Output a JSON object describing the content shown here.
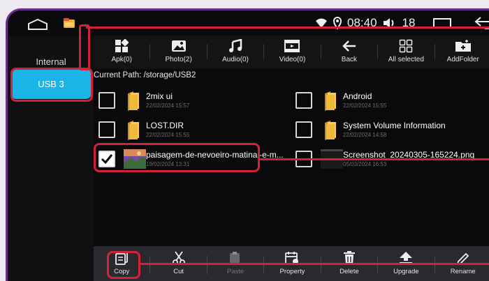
{
  "status": {
    "time": "08:40",
    "volume": "18",
    "volume_icon": "speaker-icon",
    "wifi_icon": "wifi-icon",
    "location_icon": "location-pin-icon"
  },
  "sidebar": {
    "items": [
      {
        "label": "Internal"
      },
      {
        "label": "USB 3",
        "selected": true
      }
    ]
  },
  "toolbar": {
    "items": [
      {
        "label": "Apk(0)",
        "icon": "apps-icon"
      },
      {
        "label": "Photo(2)",
        "icon": "image-icon"
      },
      {
        "label": "Audio(0)",
        "icon": "music-note-icon"
      },
      {
        "label": "Video(0)",
        "icon": "film-icon"
      },
      {
        "label": "Back",
        "icon": "arrow-left-icon"
      },
      {
        "label": "All selected",
        "icon": "grid-icon"
      },
      {
        "label": "AddFolder",
        "icon": "add-folder-icon"
      }
    ]
  },
  "path_label": "Current Path: /storage/USB2",
  "files": [
    {
      "name": "2mix ui",
      "date": "22/02/2024 15:57",
      "type": "folder",
      "checked": false
    },
    {
      "name": "Android",
      "date": "22/02/2024 15:55",
      "type": "folder",
      "checked": false
    },
    {
      "name": "LOST.DIR",
      "date": "22/02/2024 15:55",
      "type": "folder",
      "checked": false
    },
    {
      "name": "System Volume Information",
      "date": "22/02/2024 14:58",
      "type": "folder",
      "checked": false
    },
    {
      "name": "paisagem-de-nevoeiro-matinal-e-m...",
      "date": "19/02/2024 13:31",
      "type": "image",
      "checked": true
    },
    {
      "name": "Screenshot_20240305-165224.png",
      "date": "05/03/2024 16:53",
      "type": "image",
      "checked": false
    }
  ],
  "bottombar": {
    "items": [
      {
        "label": "Copy",
        "icon": "copy-icon",
        "enabled": true
      },
      {
        "label": "Cut",
        "icon": "scissors-icon",
        "enabled": true
      },
      {
        "label": "Paste",
        "icon": "paste-icon",
        "enabled": false
      },
      {
        "label": "Property",
        "icon": "property-icon",
        "enabled": true
      },
      {
        "label": "Delete",
        "icon": "trash-icon",
        "enabled": true
      },
      {
        "label": "Upgrade",
        "icon": "upgrade-icon",
        "enabled": true
      },
      {
        "label": "Rename",
        "icon": "pencil-icon",
        "enabled": true
      }
    ]
  },
  "colors": {
    "accent": "#1ab4e6",
    "highlight": "#d4213a",
    "frame": "#6a2d8a"
  }
}
